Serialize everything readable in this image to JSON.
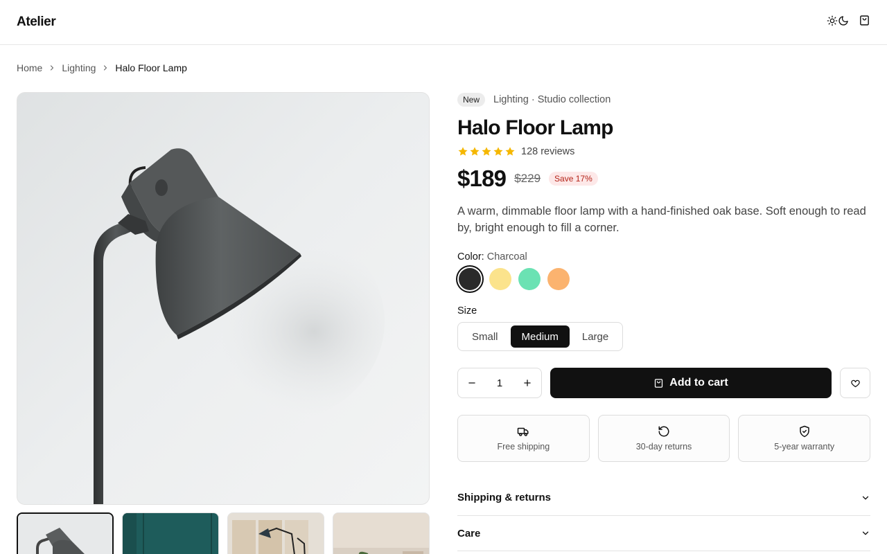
{
  "header": {
    "logo": "Atelier",
    "theme_toggle_icons": [
      "sun-icon",
      "moon-icon"
    ],
    "cart_icon": "shopping-bag-icon"
  },
  "breadcrumb": {
    "items": [
      "Home",
      "Lighting"
    ],
    "current": "Halo Floor Lamp"
  },
  "gallery": {
    "main_image": "grey metal floor lamp against white wall",
    "thumbnails": [
      "grey lamp close-up",
      "pendant lamp on teal wall",
      "black arc lamp in room",
      "lamp in living room with plants"
    ],
    "active_thumbnail": 0
  },
  "product": {
    "badge": "New",
    "category": "Lighting · Studio collection",
    "title": "Halo Floor Lamp",
    "rating": 5,
    "reviews": "128 reviews",
    "price": "$189",
    "old_price": "$229",
    "save": "Save 17%",
    "description": "A warm, dimmable floor lamp with a hand-finished oak base. Soft enough to read by, bright enough to fill a corner.",
    "color_label": "Color:",
    "color_value": "Charcoal",
    "colors": [
      "#2a2a2a",
      "#fbe38c",
      "#6be2b3",
      "#fbb36f"
    ],
    "selected_color": 0,
    "size_label": "Size",
    "sizes": [
      "Small",
      "Medium",
      "Large"
    ],
    "selected_size": 1,
    "quantity": "1",
    "add_to_cart": "Add to cart",
    "star_color": "#f5b700"
  },
  "features": [
    {
      "icon": "truck-icon",
      "label": "Free shipping"
    },
    {
      "icon": "rotate-icon",
      "label": "30-day returns"
    },
    {
      "icon": "shield-check-icon",
      "label": "5-year warranty"
    }
  ],
  "accordion": [
    {
      "label": "Shipping & returns"
    },
    {
      "label": "Care"
    }
  ]
}
